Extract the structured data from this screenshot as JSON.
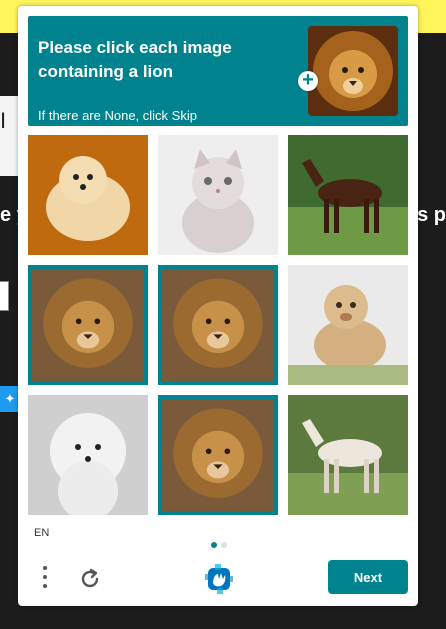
{
  "background_page": {
    "fragment_left": "e y",
    "fragment_right": "is p",
    "fragment_top": "I",
    "twitter_icon": "twitter-bird-icon"
  },
  "challenge": {
    "prompt": "Please click each image containing a lion",
    "sub_prompt": "If there are None, click Skip",
    "example_image": "lion-face",
    "tiles": [
      {
        "subject": "white puppy on orange background",
        "selected": false
      },
      {
        "subject": "white kitten",
        "selected": false
      },
      {
        "subject": "brown horse",
        "selected": false
      },
      {
        "subject": "lion",
        "selected": true
      },
      {
        "subject": "lion",
        "selected": true
      },
      {
        "subject": "lioness",
        "selected": false
      },
      {
        "subject": "white poodle",
        "selected": false
      },
      {
        "subject": "lion",
        "selected": true
      },
      {
        "subject": "white horse",
        "selected": false
      }
    ],
    "language": "EN",
    "pagination": {
      "current": 1,
      "total": 2
    },
    "next_label": "Next",
    "icons": {
      "menu": "more-vertical-icon",
      "refresh": "refresh-icon",
      "logo": "hcaptcha-logo-icon",
      "add": "plus-icon"
    },
    "accent_color": "#00838f"
  }
}
